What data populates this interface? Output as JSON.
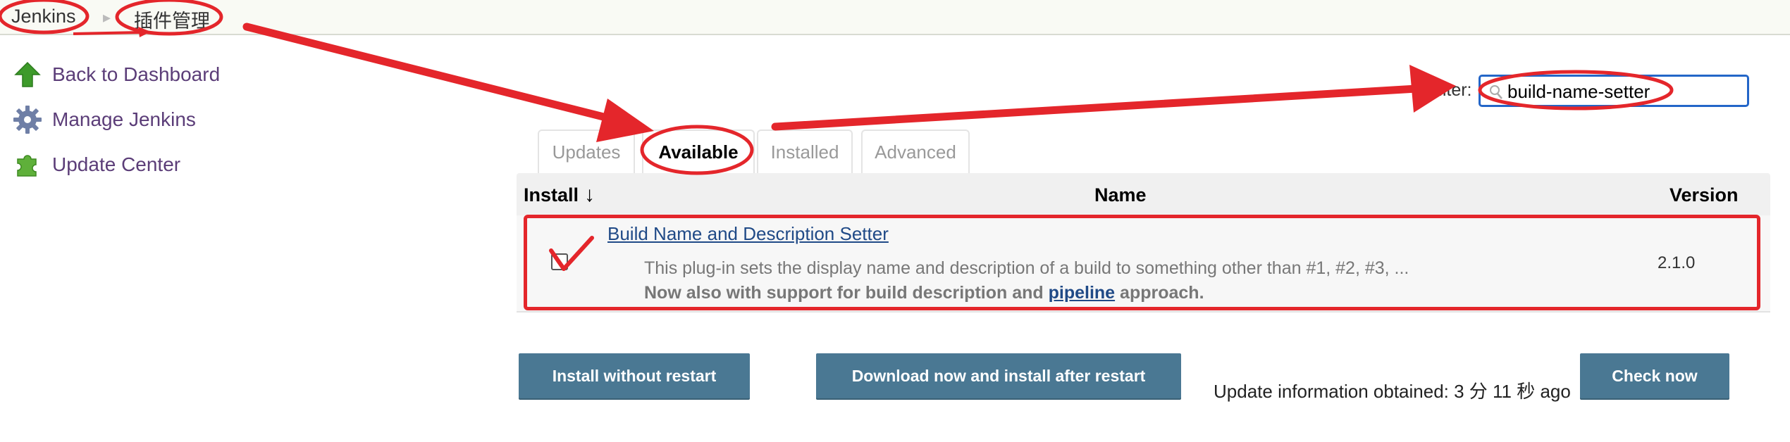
{
  "breadcrumb": {
    "root": "Jenkins",
    "current": "插件管理"
  },
  "sidebar": {
    "items": [
      {
        "label": "Back to Dashboard",
        "icon": "up-arrow-icon"
      },
      {
        "label": "Manage Jenkins",
        "icon": "gear-icon"
      },
      {
        "label": "Update Center",
        "icon": "puzzle-icon"
      }
    ]
  },
  "filter": {
    "label": "Filter:",
    "value": "build-name-setter"
  },
  "tabs": [
    {
      "label": "Updates",
      "active": false
    },
    {
      "label": "Available",
      "active": true
    },
    {
      "label": "Installed",
      "active": false
    },
    {
      "label": "Advanced",
      "active": false
    }
  ],
  "table": {
    "headers": {
      "install": "Install",
      "sort_indicator": "↓",
      "name": "Name",
      "version": "Version"
    },
    "rows": [
      {
        "name": "Build Name and Description Setter",
        "description": "This plug-in sets the display name and description of a build to something other than #1, #2, #3, ...",
        "note_prefix": "Now also with support for build description and",
        "note_link": "pipeline",
        "note_suffix": "approach.",
        "version": "2.1.0",
        "checked": false
      }
    ]
  },
  "buttons": {
    "install_without_restart": "Install without restart",
    "download_after_restart": "Download now and install after restart",
    "check_now": "Check now"
  },
  "update_info": "Update information obtained: 3 分 11 秒 ago",
  "colors": {
    "annotation_red": "#e4262b",
    "button_bg": "#4a7893",
    "link": "#204a87",
    "sidebar_link": "#5b3d78",
    "filter_border": "#2366c8"
  }
}
